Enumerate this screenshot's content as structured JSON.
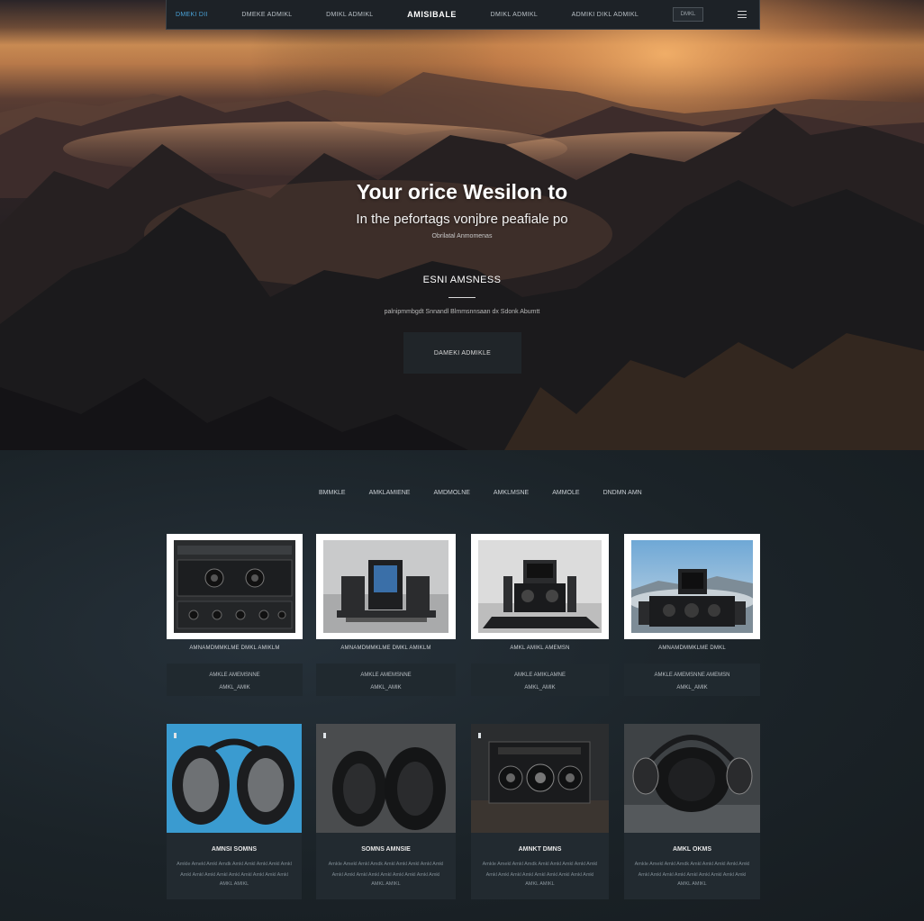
{
  "nav": {
    "items": [
      "DMEKI DII",
      "DMEKE ADMIKL",
      "DMIKL ADMIKL",
      "ADMIKI DIKL ADMIKL"
    ],
    "brand": "AMISIBALE",
    "button_label": "DMKL",
    "menu_icon": "menu-icon"
  },
  "hero": {
    "title": "Your orice  Wesilon to",
    "subtitle": "In the pefortags vonjbre peafiale po",
    "small_text": "Obrilatal Anmomenas",
    "heading": "ESNI AMSNESS",
    "description": "palnipmmbgdt Snnandl Blmmsnnsaan dx Sdonk Abumtt",
    "cta_label": "DAMEKI ADMIKLE"
  },
  "tabs": [
    "BMMKLE",
    "AMKLAMIENE",
    "AMDMOLNE",
    "AMKLMSNE",
    "AMMOLE",
    "DNDMN AMN"
  ],
  "products_top": [
    {
      "title": "AMNAMDMMKLME DMKL AMIKLM",
      "line1": "AMKLE AMEMSNNE",
      "line2": "AMKL_AMIK",
      "icon": "amplifier-image"
    },
    {
      "title": "AMNAMDMMKLME DMKL AMIKLM",
      "line1": "AMKLE AMEMSNNE",
      "line2": "AMKL_AMIK",
      "icon": "turntable-image"
    },
    {
      "title": "AMKL AMIKL AMEMSN",
      "line1": "AMKLE AMIKLAMNE",
      "line2": "AMKL_AMIK",
      "icon": "receiver-image"
    },
    {
      "title": "AMNAMDMMKLME DMKL",
      "line1": "AMKLE AMEMSNNE AMEMSN",
      "line2": "AMKL_AMIK",
      "icon": "speaker-system-image"
    }
  ],
  "products_bottom": [
    {
      "title": "AMNSI SOMNS",
      "desc": "Amkle Amekl Amkl Amdk Amkl Amkl Amkl Amkl Amkl Amkl Amkl Amkl Amkl Amkl Amkl Amkl Amkl Amkl",
      "link": "AMKL AMIKL",
      "icon": "headphones-image"
    },
    {
      "title": "SOMNS AMNSIE",
      "desc": "Amkle Amekl Amkl Amdk Amkl Amkl Amkl Amkl Amkl Amkl Amkl Amkl Amkl Amkl Amkl Amkl Amkl Amkl",
      "link": "AMKL AMIKL",
      "icon": "headphones-image"
    },
    {
      "title": "AMNKT DMNS",
      "desc": "Amkle Amekl Amkl Amdk Amkl Amkl Amkl Amkl Amkl Amkl Amkl Amkl Amkl Amkl Amkl Amkl Amkl Amkl",
      "link": "AMKL AMIKL",
      "icon": "boombox-image"
    },
    {
      "title": "AMKL OKMS",
      "desc": "Amkle Amekl Amkl Amdk Amkl Amkl Amkl Amkl Amkl Amkl Amkl Amkl Amkl Amkl Amkl Amkl Amkl Amkl",
      "link": "AMKL AMIKL",
      "icon": "headphones-image"
    }
  ],
  "colors": {
    "accent": "#4aa3d8",
    "nav_bg": "#1d2227",
    "section_bg": "#1b2328",
    "card_bg": "#222a30"
  }
}
